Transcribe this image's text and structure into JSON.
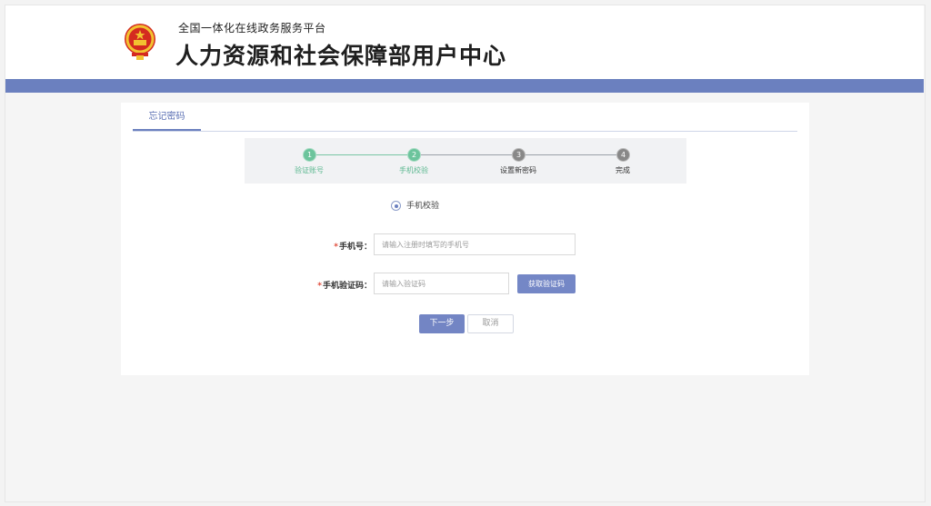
{
  "header": {
    "platform_name": "全国一体化在线政务服务平台",
    "site_title": "人力资源和社会保障部用户中心"
  },
  "tabs": [
    {
      "label": "忘记密码",
      "active": true
    }
  ],
  "steps": [
    {
      "number": "1",
      "label": "验证账号",
      "status": "done"
    },
    {
      "number": "2",
      "label": "手机校验",
      "status": "done"
    },
    {
      "number": "3",
      "label": "设置新密码",
      "status": "todo"
    },
    {
      "number": "4",
      "label": "完成",
      "status": "todo"
    }
  ],
  "verify_method": {
    "label": "手机校验",
    "selected": true
  },
  "form": {
    "required_mark": "*",
    "phone": {
      "label": "手机号：",
      "placeholder": "请输入注册时填写的手机号",
      "value": ""
    },
    "code": {
      "label": "手机验证码：",
      "placeholder": "请输入验证码",
      "value": ""
    },
    "get_code_label": "获取验证码"
  },
  "actions": {
    "next_label": "下一步",
    "cancel_label": "取消"
  },
  "colors": {
    "brand_blue": "#6b80bf",
    "step_done_green": "#6cc49c",
    "step_todo_gray": "#888888",
    "required_red": "#e04b3a"
  },
  "icons": {
    "emblem": "national-emblem-icon",
    "radio": "radio-selected-icon"
  }
}
